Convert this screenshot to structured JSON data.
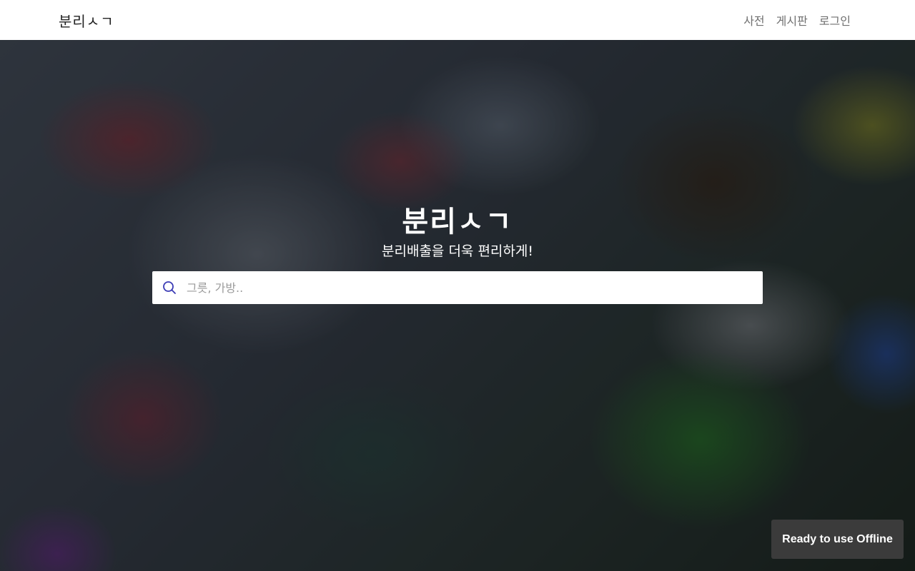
{
  "navbar": {
    "brand": "분리ㅅㄱ",
    "links": [
      {
        "label": "사전"
      },
      {
        "label": "게시판"
      },
      {
        "label": "로그인"
      }
    ]
  },
  "hero": {
    "title": "분리ㅅㄱ",
    "subtitle": "분리배출을 더욱 편리하게!",
    "search": {
      "placeholder": "그릇, 가방..",
      "value": "",
      "icon": "search-icon",
      "icon_color": "#3b3bb5"
    }
  },
  "toast": {
    "message": "Ready to use Offline"
  }
}
